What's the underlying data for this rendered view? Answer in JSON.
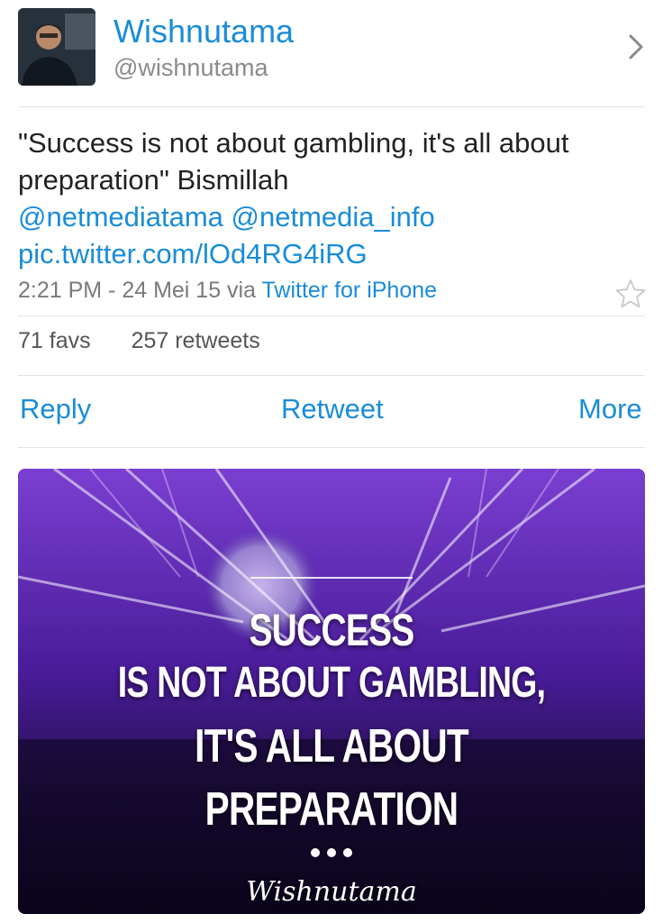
{
  "user": {
    "name": "Wishnutama",
    "handle": "@wishnutama"
  },
  "tweet": {
    "text_plain": "\"Success is not about gambling, it's all about preparation\" Bismillah",
    "mention_1": "@netmediatama",
    "mention_2": "@netmedia_info",
    "link": "pic.twitter.com/lOd4RG4iRG",
    "time": "2:21 PM - 24 Mei 15 via",
    "via": "Twitter for iPhone"
  },
  "stats": {
    "favs": "71 favs",
    "retweets": "257 retweets"
  },
  "actions": {
    "reply": "Reply",
    "retweet": "Retweet",
    "more": "More"
  },
  "media": {
    "quote_line_1": "SUCCESS",
    "quote_line_2": "IS NOT ABOUT GAMBLING,",
    "quote_line_3": "IT'S ALL ABOUT",
    "quote_line_4": "PREPARATION",
    "signature": "Wishnutama"
  },
  "icons": {
    "chevron": "chevron-right-icon",
    "star": "star-outline-icon"
  },
  "colors": {
    "link": "#1a8cd8",
    "media_bg": "#1a0a3a"
  }
}
